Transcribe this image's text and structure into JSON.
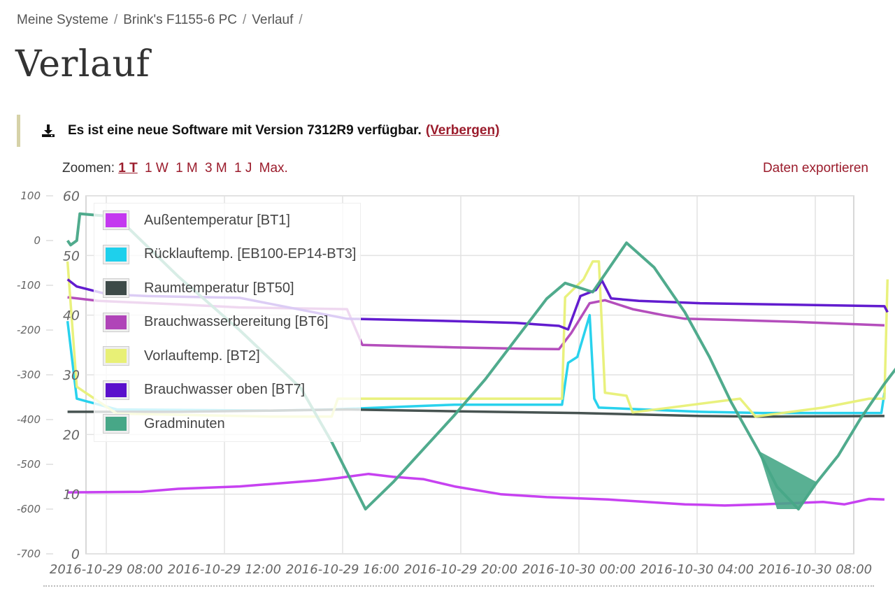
{
  "breadcrumb": [
    "Meine Systeme",
    "Brink's F1155-6 PC",
    "Verlauf"
  ],
  "breadcrumb_sep": "/",
  "page_title": "Verlauf",
  "notice": {
    "icon": "download-icon",
    "text": "Es ist eine neue Software mit Version 7312R9 verfügbar.",
    "hide_label": "(Verbergen)"
  },
  "zoom": {
    "label": "Zoomen:",
    "options": [
      "1 T",
      "1 W",
      "1 M",
      "3 M",
      "1 J",
      "Max."
    ],
    "active": "1 T"
  },
  "export_label": "Daten exportieren",
  "colors": {
    "link": "#9b1c2c",
    "accent_bar": "#d6d2a8"
  },
  "chart_data": {
    "type": "line",
    "x_ticks": [
      "2016-10-29 08:00",
      "2016-10-29 12:00",
      "2016-10-29 16:00",
      "2016-10-29 20:00",
      "2016-10-30 00:00",
      "2016-10-30 04:00",
      "2016-10-30 08:00"
    ],
    "x_range_hours": [
      0,
      25
    ],
    "y_left": {
      "ticks": [
        "60",
        "50",
        "40",
        "30",
        "20",
        "10",
        "0"
      ],
      "range": [
        0,
        60
      ]
    },
    "y_right": {
      "ticks": [
        "100",
        "0",
        "-100",
        "-200",
        "-300",
        "-400",
        "-500",
        "-600",
        "-700"
      ],
      "range": [
        -700,
        100
      ]
    },
    "grid": true,
    "legend_position": "top-left",
    "series": [
      {
        "name": "Außentemperatur [BT1]",
        "color": "#c438f0",
        "axis": "left",
        "points": [
          [
            -0.6,
            10.3
          ],
          [
            1.8,
            10.4
          ],
          [
            3,
            10.9
          ],
          [
            5,
            11.3
          ],
          [
            7.5,
            12.3
          ],
          [
            8.2,
            12.7
          ],
          [
            9.2,
            13.4
          ],
          [
            10,
            12.9
          ],
          [
            11,
            12.5
          ],
          [
            12,
            11.3
          ],
          [
            13.5,
            10
          ],
          [
            15,
            9.5
          ],
          [
            17,
            9.1
          ],
          [
            19.5,
            8.3
          ],
          [
            20.2,
            8.2
          ],
          [
            20.8,
            8.1
          ],
          [
            22,
            8.3
          ],
          [
            24,
            8.7
          ],
          [
            24.7,
            8.3
          ],
          [
            25.5,
            9.2
          ],
          [
            26,
            9.1
          ]
        ]
      },
      {
        "name": "Rücklauftemp. [EB100-EP14-BT3]",
        "color": "#1ed0ec",
        "axis": "left",
        "points": [
          [
            -0.6,
            39
          ],
          [
            -0.3,
            26
          ],
          [
            1,
            24.2
          ],
          [
            6,
            24
          ],
          [
            8,
            24.2
          ],
          [
            11,
            24.8
          ],
          [
            12,
            25
          ],
          [
            15.5,
            25
          ],
          [
            15.7,
            32
          ],
          [
            16,
            33
          ],
          [
            16.4,
            40
          ],
          [
            16.55,
            26
          ],
          [
            16.7,
            24.5
          ],
          [
            20,
            23.8
          ],
          [
            22,
            23.6
          ],
          [
            25.5,
            23.6
          ],
          [
            25.9,
            23.6
          ],
          [
            26,
            27
          ]
        ]
      },
      {
        "name": "Raumtemperatur [BT50]",
        "color": "#3d4a48",
        "axis": "left",
        "points": [
          [
            -0.6,
            23.8
          ],
          [
            3,
            23.8
          ],
          [
            6,
            24
          ],
          [
            8.5,
            24.2
          ],
          [
            12,
            23.9
          ],
          [
            16,
            23.6
          ],
          [
            20,
            23.1
          ],
          [
            22,
            23
          ],
          [
            26,
            23.1
          ]
        ]
      },
      {
        "name": "Brauchwasserbereitung [BT6]",
        "color": "#b044b8",
        "axis": "left",
        "points": [
          [
            -0.6,
            43
          ],
          [
            0.4,
            42.4
          ],
          [
            3,
            41.8
          ],
          [
            5,
            41.3
          ],
          [
            8.5,
            41
          ],
          [
            9,
            35
          ],
          [
            12,
            34.6
          ],
          [
            14,
            34.4
          ],
          [
            15.4,
            34.3
          ],
          [
            15.8,
            37
          ],
          [
            16.4,
            42
          ],
          [
            16.9,
            42.5
          ],
          [
            17.8,
            41
          ],
          [
            18.8,
            40
          ],
          [
            19.5,
            39.4
          ],
          [
            21,
            39.2
          ],
          [
            23,
            38.9
          ],
          [
            26,
            38.3
          ]
        ]
      },
      {
        "name": "Vorlauftemp. [BT2]",
        "color": "#e8f076",
        "axis": "left",
        "points": [
          [
            -0.6,
            49
          ],
          [
            -0.3,
            28
          ],
          [
            1,
            23.5
          ],
          [
            6,
            23
          ],
          [
            8,
            23
          ],
          [
            8.2,
            26
          ],
          [
            12,
            26
          ],
          [
            15.5,
            26
          ],
          [
            15.6,
            43
          ],
          [
            16.2,
            46
          ],
          [
            16.5,
            49
          ],
          [
            16.7,
            49
          ],
          [
            16.9,
            27
          ],
          [
            17.6,
            26.5
          ],
          [
            17.8,
            23.7
          ],
          [
            21.3,
            26
          ],
          [
            21.8,
            23
          ],
          [
            24,
            24.5
          ],
          [
            25.5,
            26
          ],
          [
            26,
            26
          ],
          [
            26.1,
            46
          ]
        ]
      },
      {
        "name": "Brauchwasser oben [BT7]",
        "color": "#5a10cc",
        "axis": "left",
        "points": [
          [
            -0.6,
            46
          ],
          [
            -0.3,
            44.8
          ],
          [
            0.7,
            43.5
          ],
          [
            2,
            43.2
          ],
          [
            5,
            42.9
          ],
          [
            8.5,
            39.4
          ],
          [
            12,
            39
          ],
          [
            14,
            38.7
          ],
          [
            15.4,
            38.2
          ],
          [
            15.7,
            37.6
          ],
          [
            16.1,
            43.2
          ],
          [
            16.6,
            44.2
          ],
          [
            16.8,
            45.8
          ],
          [
            17.1,
            42.8
          ],
          [
            18,
            42.4
          ],
          [
            19,
            42.2
          ],
          [
            20,
            42
          ],
          [
            26,
            41.5
          ],
          [
            26.1,
            40.5
          ]
        ]
      },
      {
        "name": "Gradminuten",
        "color": "#47a787",
        "axis": "right",
        "points": [
          [
            -0.6,
            0
          ],
          [
            -0.5,
            -10
          ],
          [
            -0.3,
            0
          ],
          [
            -0.2,
            60
          ],
          [
            0.6,
            55
          ],
          [
            1.2,
            40
          ],
          [
            3,
            -80
          ],
          [
            5,
            -200
          ],
          [
            7,
            -330
          ],
          [
            8,
            -450
          ],
          [
            9.1,
            -600
          ],
          [
            10,
            -540
          ],
          [
            12,
            -390
          ],
          [
            13,
            -310
          ],
          [
            14,
            -220
          ],
          [
            15,
            -130
          ],
          [
            15.6,
            -95
          ],
          [
            16.5,
            -115
          ],
          [
            17.6,
            -5
          ],
          [
            18.5,
            -60
          ],
          [
            19.5,
            -160
          ],
          [
            20.3,
            -260
          ],
          [
            21,
            -360
          ],
          [
            21.9,
            -470
          ],
          [
            22.5,
            -550
          ],
          [
            23.2,
            -600
          ],
          [
            23.8,
            -540
          ],
          [
            24.5,
            -480
          ],
          [
            25.2,
            -400
          ],
          [
            26,
            -320
          ],
          [
            27,
            -230
          ],
          [
            27.8,
            -150
          ],
          [
            28.8,
            -50
          ],
          [
            29.8,
            0
          ]
        ]
      }
    ]
  }
}
